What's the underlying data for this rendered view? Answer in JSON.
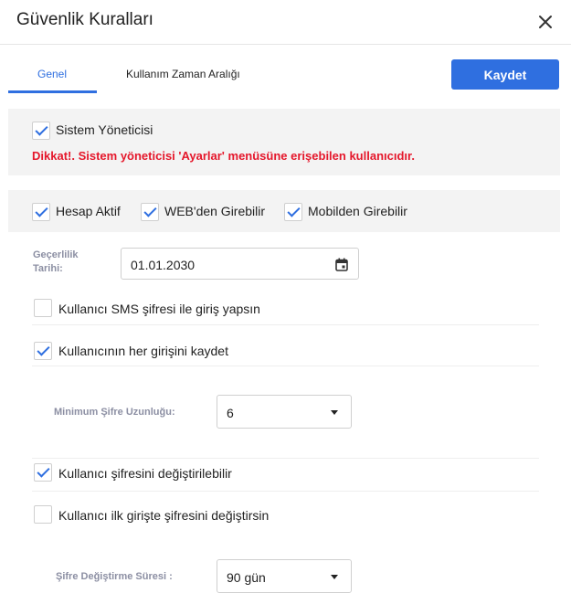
{
  "dialog": {
    "title": "Güvenlik Kuralları"
  },
  "tabs": [
    {
      "label": "Genel",
      "active": true
    },
    {
      "label": "Kullanım Zaman Aralığı",
      "active": false
    }
  ],
  "save_label": "Kaydet",
  "admin": {
    "checkbox_label": "Sistem Yöneticisi",
    "checked": true,
    "warning": "Dikkat!. Sistem yöneticisi 'Ayarlar' menüsüne erişebilen kullanıcıdır."
  },
  "access": {
    "hesap_aktif": "Hesap Aktif",
    "web": "WEB'den Girebilir",
    "mobil": "Mobilden Girebilir"
  },
  "validity": {
    "label": "Geçerlilik Tarihi:",
    "value": "01.01.2030"
  },
  "options": {
    "sms": {
      "label": "Kullanıcı SMS şifresi ile giriş yapsın",
      "checked": false
    },
    "log": {
      "label": "Kullanıcının her girişini kaydet",
      "checked": true
    },
    "change": {
      "label": "Kullanıcı şifresini değiştirilebilir",
      "checked": true
    },
    "first_login": {
      "label": "Kullanıcı ilk girişte şifresini değiştirsin",
      "checked": false
    }
  },
  "min_length": {
    "label": "Minimum Şifre Uzunluğu:",
    "value": "6"
  },
  "change_period": {
    "label": "Şifre Değiştirme Süresi :",
    "value": "90 gün"
  },
  "colors": {
    "accent": "#2f6fe0",
    "warning": "#e5172b",
    "panel": "#f3f3f3"
  }
}
